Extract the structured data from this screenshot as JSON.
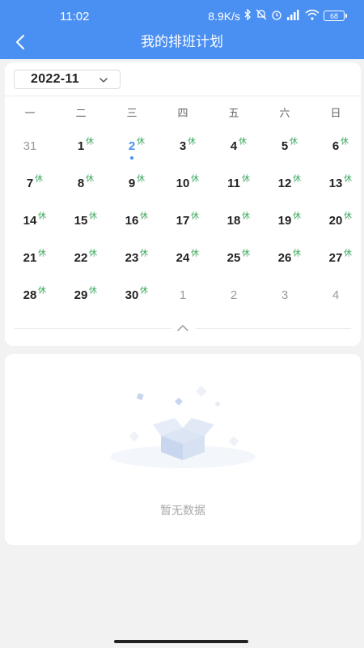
{
  "status_bar": {
    "time": "11:02",
    "net_speed": "8.9K/s",
    "battery": "68",
    "icons": [
      "bluetooth-icon",
      "mute-icon",
      "alarm-icon",
      "signal-icon",
      "wifi-icon",
      "battery-icon"
    ]
  },
  "nav": {
    "title": "我的排班计划",
    "back_icon": "chevron-left-icon"
  },
  "calendar": {
    "month": "2022-11",
    "weekdays": [
      "一",
      "二",
      "三",
      "四",
      "五",
      "六",
      "日"
    ],
    "rest_label": "休",
    "today": "2",
    "weeks": [
      [
        {
          "n": "31",
          "other": true,
          "rest": false
        },
        {
          "n": "1",
          "rest": true
        },
        {
          "n": "2",
          "rest": true,
          "today": true
        },
        {
          "n": "3",
          "rest": true
        },
        {
          "n": "4",
          "rest": true
        },
        {
          "n": "5",
          "rest": true
        },
        {
          "n": "6",
          "rest": true
        }
      ],
      [
        {
          "n": "7",
          "rest": true
        },
        {
          "n": "8",
          "rest": true
        },
        {
          "n": "9",
          "rest": true
        },
        {
          "n": "10",
          "rest": true
        },
        {
          "n": "11",
          "rest": true
        },
        {
          "n": "12",
          "rest": true
        },
        {
          "n": "13",
          "rest": true
        }
      ],
      [
        {
          "n": "14",
          "rest": true
        },
        {
          "n": "15",
          "rest": true
        },
        {
          "n": "16",
          "rest": true
        },
        {
          "n": "17",
          "rest": true
        },
        {
          "n": "18",
          "rest": true
        },
        {
          "n": "19",
          "rest": true
        },
        {
          "n": "20",
          "rest": true
        }
      ],
      [
        {
          "n": "21",
          "rest": true
        },
        {
          "n": "22",
          "rest": true
        },
        {
          "n": "23",
          "rest": true
        },
        {
          "n": "24",
          "rest": true
        },
        {
          "n": "25",
          "rest": true
        },
        {
          "n": "26",
          "rest": true
        },
        {
          "n": "27",
          "rest": true
        }
      ],
      [
        {
          "n": "28",
          "rest": true
        },
        {
          "n": "29",
          "rest": true
        },
        {
          "n": "30",
          "rest": true
        },
        {
          "n": "1",
          "other": true,
          "rest": false
        },
        {
          "n": "2",
          "other": true,
          "rest": false
        },
        {
          "n": "3",
          "other": true,
          "rest": false
        },
        {
          "n": "4",
          "other": true,
          "rest": false
        }
      ]
    ]
  },
  "empty_state": {
    "text": "暂无数据",
    "icon": "empty-box-icon"
  },
  "colors": {
    "primary": "#4a8ff2",
    "rest": "#3aa55a",
    "background": "#f2f2f2"
  }
}
